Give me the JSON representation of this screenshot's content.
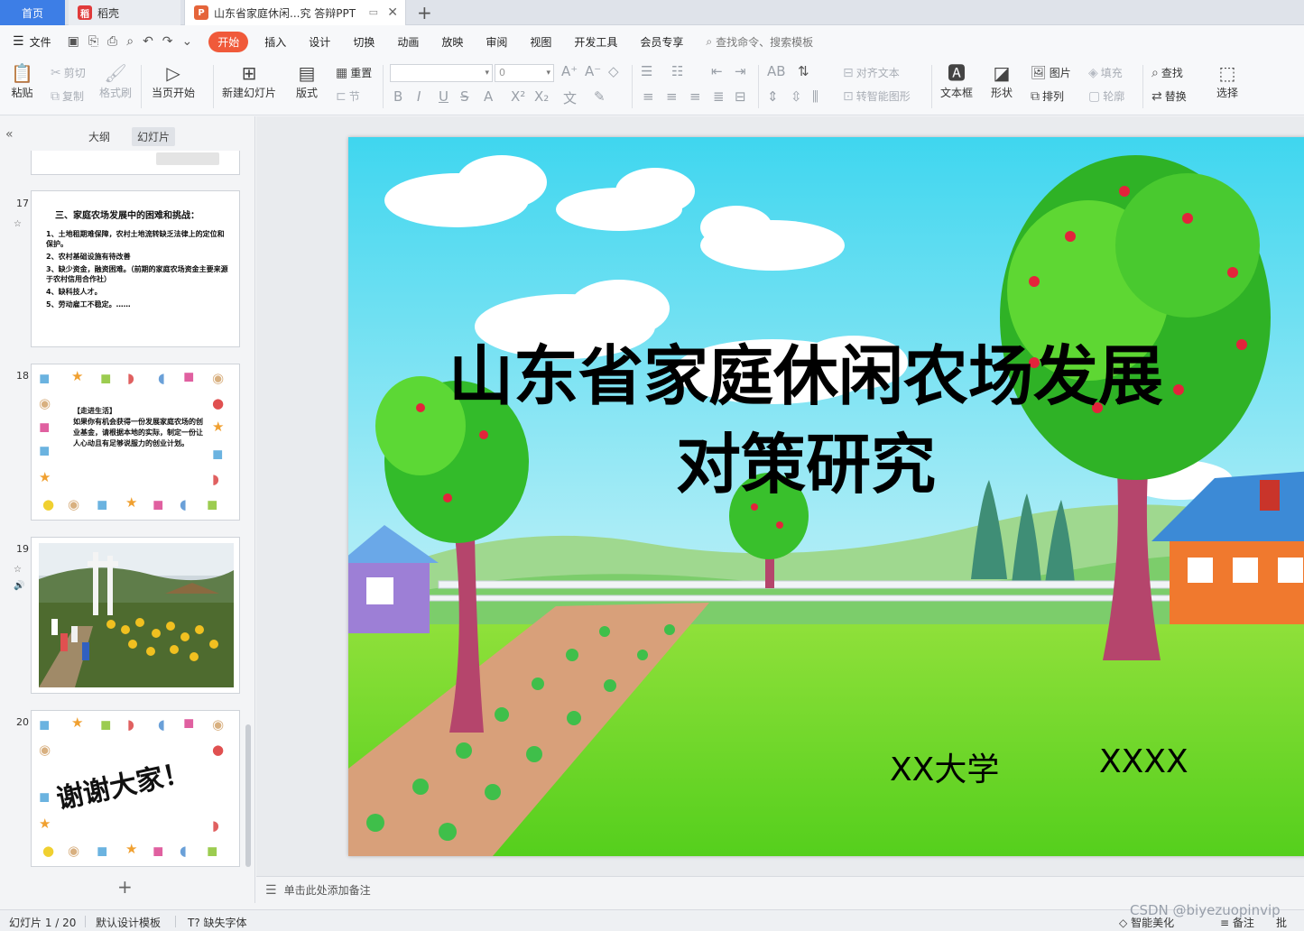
{
  "tabs": {
    "home": "首页",
    "daoke": "稻壳",
    "doc": "山东省家庭休闲...究 答辩PPT"
  },
  "menu": {
    "file": "文件",
    "items": [
      "开始",
      "插入",
      "设计",
      "切换",
      "动画",
      "放映",
      "审阅",
      "视图",
      "开发工具",
      "会员专享"
    ],
    "search": "查找命令、搜索模板"
  },
  "ribbon": {
    "paste": "粘贴",
    "cut": "剪切",
    "copy": "复制",
    "format_painter": "格式刷",
    "from_start": "当页开始",
    "new_slide": "新建幻灯片",
    "layout": "版式",
    "reset": "重置",
    "section": "节",
    "font_size": "0",
    "align_text": "对齐文本",
    "smart_shape": "转智能图形",
    "textbox": "文本框",
    "shape": "形状",
    "picture": "图片",
    "arrange": "排列",
    "fill": "填充",
    "outline": "轮廓",
    "find": "查找",
    "replace": "替换",
    "select": "选择"
  },
  "left_panel": {
    "tab_outline": "大纲",
    "tab_slides": "幻灯片"
  },
  "slides": {
    "s17": {
      "num": "17",
      "title": "三、家庭农场发展中的困难和挑战：",
      "items": [
        "1、土地租期难保障，农村土地流转缺乏法律上的定位和保护。",
        "2、农村基础设施有待改善",
        "3、缺少资金，融资困难。（前期的家庭农场资金主要来源于农村信用合作社）",
        "4、缺科技人才。",
        "5、劳动雇工不稳定。……"
      ]
    },
    "s18": {
      "num": "18",
      "heading": "【走进生活】",
      "body": "如果你有机会获得一份发展家庭农场的创业基金，请根据本地的实际，制定一份让人心动且有足够说服力的创业计划。"
    },
    "s19": {
      "num": "19"
    },
    "s20": {
      "num": "20",
      "text": "谢谢大家！"
    }
  },
  "slide_main": {
    "title_line1": "山东省家庭休闲农场发展",
    "title_line2": "对策研究",
    "university": "XX大学",
    "author": "XXXX"
  },
  "notes": {
    "placeholder": "单击此处添加备注"
  },
  "status": {
    "slide_counter": "幻灯片 1 / 20",
    "template": "默认设计模板",
    "missing_font": "缺失字体",
    "beautify": "智能美化",
    "notes": "备注",
    "comment": "批"
  },
  "watermark": "CSDN @biyezuopinvip"
}
